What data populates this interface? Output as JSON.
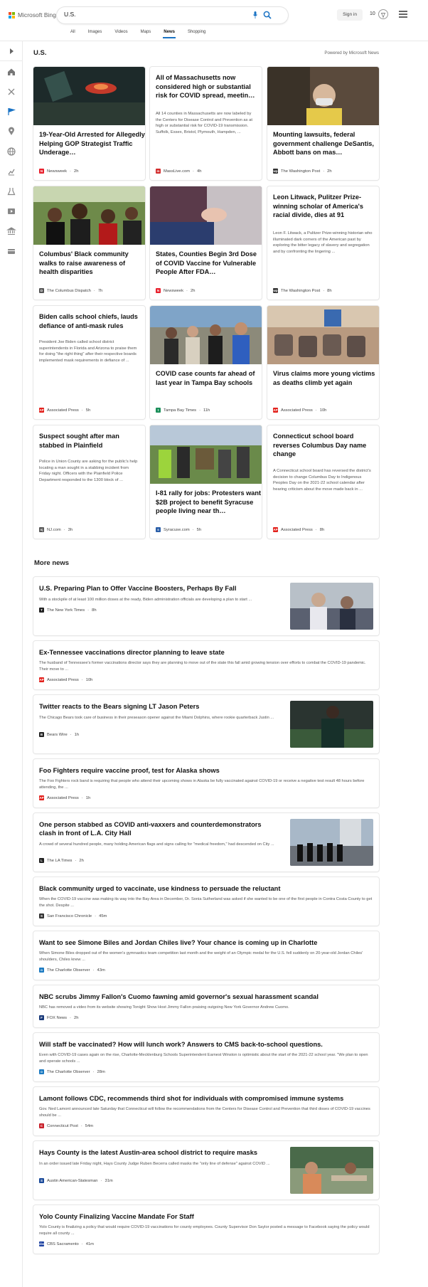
{
  "header": {
    "logo_text": "Microsoft Bing",
    "search_value": "U.S.",
    "signin_label": "Sign in",
    "rewards_count": "10",
    "tabs": [
      {
        "label": "All"
      },
      {
        "label": "Images"
      },
      {
        "label": "Videos"
      },
      {
        "label": "Maps"
      },
      {
        "label": "News",
        "active": true
      },
      {
        "label": "Shopping"
      }
    ]
  },
  "sidebar": {
    "icons": [
      "chevron-right-icon",
      "home-icon",
      "sparkle-icon",
      "flag-icon",
      "location-icon",
      "globe-icon",
      "chart-icon",
      "science-icon",
      "video-icon",
      "bank-icon",
      "card-icon"
    ]
  },
  "section": {
    "title": "U.S.",
    "powered_by": "Powered by Microsoft News"
  },
  "cards": [
    {
      "title": "19-Year-Old Arrested for Allegedly Helping GOP Strategist Traffic Underage…",
      "desc": "",
      "source": "Newsweek",
      "time": "2h",
      "favicon": "N",
      "favicon_color": "#e8212d",
      "has_image": true
    },
    {
      "title": "All of Massachusetts now considered high or substantial risk for COVID spread, meetin…",
      "desc": "All 14 counties in Massachusetts are now labeled by the Centers for Disease Control and Prevention as at high or substantial risk for COVID-19 transmission. Suffolk, Essex, Bristol, Plymouth, Hampden, ...",
      "source": "MassLive.com",
      "time": "4h",
      "favicon": "m",
      "favicon_color": "#d22d2d",
      "has_image": false
    },
    {
      "title": "Mounting lawsuits, federal government challenge DeSantis, Abbott bans on mas…",
      "desc": "",
      "source": "The Washington Post",
      "time": "2h",
      "favicon": "wp",
      "favicon_color": "#333333",
      "has_image": true
    },
    {
      "title": "Columbus' Black community walks to raise awareness of health disparities",
      "desc": "",
      "source": "The Columbus Dispatch",
      "time": "7h",
      "favicon": "D",
      "favicon_color": "#555555",
      "has_image": true
    },
    {
      "title": "States, Counties Begin 3rd Dose of COVID Vaccine for Vulnerable People After FDA…",
      "desc": "",
      "source": "Newsweek",
      "time": "2h",
      "favicon": "N",
      "favicon_color": "#e8212d",
      "has_image": true
    },
    {
      "title": "Leon Litwack, Pulitzer Prize-winning scholar of America's racial divide, dies at 91",
      "desc": "Leon F. Litwack, a Pulitzer Prize-winning historian who illuminated dark corners of the American past by exploring the bitter legacy of slavery and segregation and by confronting the lingering ...",
      "source": "The Washington Post",
      "time": "8h",
      "favicon": "wp",
      "favicon_color": "#333333",
      "has_image": false
    },
    {
      "title": "Biden calls school chiefs, lauds defiance of anti-mask rules",
      "desc": "President Joe Biden called school district superintendents in Florida and Arizona to praise them for doing \"the right thing\" after their respective boards implemented mask requirements in defiance of ...",
      "source": "Associated Press",
      "time": "5h",
      "favicon": "AP",
      "favicon_color": "#e2211c",
      "has_image": false
    },
    {
      "title": "COVID case counts far ahead of last year in Tampa Bay schools",
      "desc": "",
      "source": "Tampa Bay Times",
      "time": "11h",
      "favicon": "t",
      "favicon_color": "#1b8f5a",
      "has_image": true
    },
    {
      "title": "Virus claims more young victims as deaths climb yet again",
      "desc": "",
      "source": "Associated Press",
      "time": "10h",
      "favicon": "AP",
      "favicon_color": "#e2211c",
      "has_image": true
    },
    {
      "title": "Suspect sought after man stabbed in Plainfield",
      "desc": "Police in Union County are asking for the public's help locating a man sought in a stabbing incident from Friday night. Officers with the Plainfield Police Department responded to the 1300 block of ...",
      "source": "NJ.com",
      "time": "3h",
      "favicon": "nj",
      "favicon_color": "#555555",
      "has_image": false
    },
    {
      "title": "I-81 rally for jobs: Protesters want $2B project to benefit Syracuse people living near th…",
      "desc": "",
      "source": "Syracuse.com",
      "time": "5h",
      "favicon": "s",
      "favicon_color": "#2a5ea8",
      "has_image": true
    },
    {
      "title": "Connecticut school board reverses Columbus Day name change",
      "desc": "A Connecticut school board has reversed the district's decision to change Columbus Day to Indigenous Peoples Day on the 2021-22 school calendar after hearing criticism about the move made back in ...",
      "source": "Associated Press",
      "time": "8h",
      "favicon": "AP",
      "favicon_color": "#e2211c",
      "has_image": false
    }
  ],
  "more_news": {
    "title": "More news",
    "items": [
      {
        "title": "U.S. Preparing Plan to Offer Vaccine Boosters, Perhaps By Fall",
        "desc": "With a stockpile of at least 100 million doses at the ready, Biden administration officials are developing a plan to start ...",
        "source": "The New York Times",
        "time": "8h",
        "favicon": "T",
        "favicon_color": "#222222",
        "has_image": true
      },
      {
        "title": "Ex-Tennessee vaccinations director planning to leave state",
        "desc": "The husband of Tennessee's former vaccinations director says they are planning to move out of the state this fall amid growing tension over efforts to combat the COVID-19 pandemic. Their move to ...",
        "source": "Associated Press",
        "time": "10h",
        "favicon": "AP",
        "favicon_color": "#e2211c",
        "has_image": false
      },
      {
        "title": "Twitter reacts to the Bears signing LT Jason Peters",
        "desc": "The Chicago Bears took care of business in their preseason opener against the Miami Dolphins, where rookie quarterback Justin ...",
        "source": "Bears Wire",
        "time": "1h",
        "favicon": "B",
        "favicon_color": "#222222",
        "has_image": true
      },
      {
        "title": "Foo Fighters require vaccine proof, test for Alaska shows",
        "desc": "The Foo Fighters rock band is requiring that people who attend their upcoming shows in Alaska be fully vaccinated against COVID-19 or receive a negative test result 48 hours before attending, the ...",
        "source": "Associated Press",
        "time": "1h",
        "favicon": "AP",
        "favicon_color": "#e2211c",
        "has_image": false
      },
      {
        "title": "One person stabbed as COVID anti-vaxxers and counterdemonstrators clash in front of L.A. City Hall",
        "desc": "A crowd of several hundred people, many holding American flags and signs calling for \"medical freedom,\" had descended on City ...",
        "source": "The LA Times",
        "time": "2h",
        "favicon": "L",
        "favicon_color": "#222222",
        "has_image": true
      },
      {
        "title": "Black community urged to vaccinate, use kindness to persuade the reluctant",
        "desc": "When the COVID-19 vaccine was making its way into the Bay Area in December, Dr. Sonia Sutherland was asked if she wanted to be one of the first people in Contra Costa County to get the shot. Despite ...",
        "source": "San Francisco Chronicle",
        "time": "45m",
        "favicon": "S",
        "favicon_color": "#333333",
        "has_image": false
      },
      {
        "title": "Want to see Simone Biles and Jordan Chiles live? Your chance is coming up in Charlotte",
        "desc": "When Simone Biles dropped out of the women's gymnastics team competition last month and the weight of an Olympic medal for the U.S. fell suddenly on 20-year-old Jordan Chiles' shoulders, Chiles knew ...",
        "source": "The Charlotte Observer",
        "time": "43m",
        "favicon": "o",
        "favicon_color": "#1d7bc2",
        "has_image": false
      },
      {
        "title": "NBC scrubs Jimmy Fallon's Cuomo fawning amid governor's sexual harassment scandal",
        "desc": "NBC has removed a video from its website showing Tonight Show Host Jimmy Fallon praising outgoing New York Governor Andrew Cuomo.",
        "source": "FOX News",
        "time": "2h",
        "favicon": "F",
        "favicon_color": "#1a3a7a",
        "has_image": false
      },
      {
        "title": "Will staff be vaccinated? How will lunch work? Answers to CMS back-to-school questions.",
        "desc": "Even with COVID-19 cases again on the rise, Charlotte-Mecklenburg Schools Superintendent Earnest Winston is optimistic about the start of the 2021-22 school year. \"We plan to open and operate schools ...",
        "source": "The Charlotte Observer",
        "time": "28m",
        "favicon": "o",
        "favicon_color": "#1d7bc2",
        "has_image": false
      },
      {
        "title": "Lamont follows CDC, recommends third shot for individuals with compromised immune systems",
        "desc": "Gov. Ned Lamont announced late Saturday that Connecticut will follow the recommendations from the Centers for Disease Control and Prevention that third doses of COVID-19 vaccines should be ...",
        "source": "Connecticut Post",
        "time": "54m",
        "favicon": "C",
        "favicon_color": "#c8202a",
        "has_image": false
      },
      {
        "title": "Hays County is the latest Austin-area school district to require masks",
        "desc": "In an order issued late Friday night, Hays County Judge Ruben Becerra called masks the \"only line of defense\" against COVID ...",
        "source": "Austin American-Statesman",
        "time": "31m",
        "favicon": "S",
        "favicon_color": "#1a4a9a",
        "has_image": true
      },
      {
        "title": "Yolo County Finalizing Vaccine Mandate For Staff",
        "desc": "Yolo County is finalizing a policy that would require COVID-19 vaccinations for county employees. County Supervisor Don Saylor posted a message to Facebook saying the policy would require all county ...",
        "source": "CBS Sacramento",
        "time": "41m",
        "favicon": "cbs",
        "favicon_color": "#1a3fa0",
        "has_image": false
      }
    ]
  }
}
